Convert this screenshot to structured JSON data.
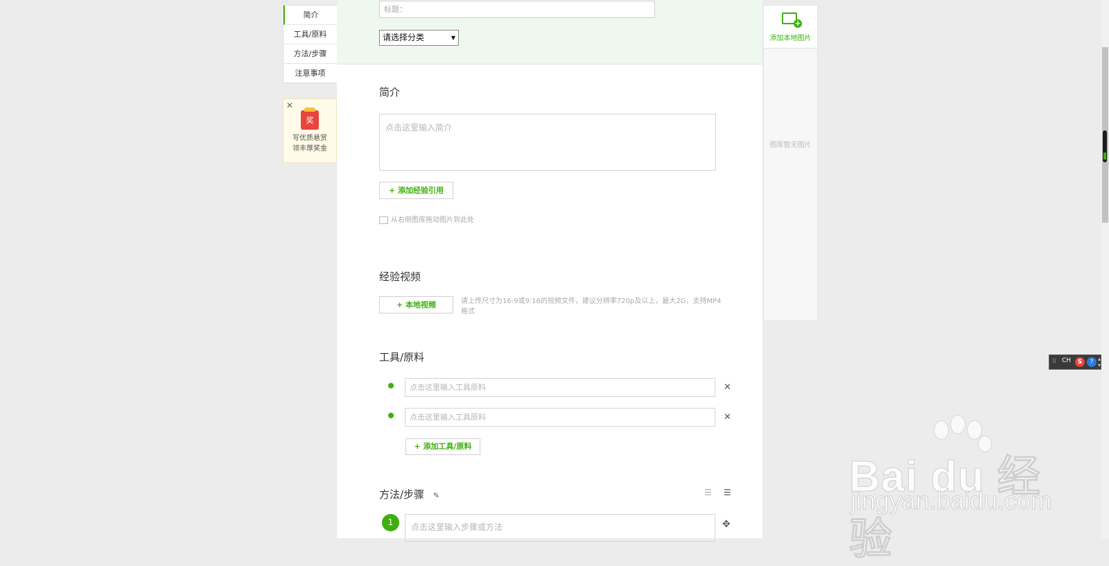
{
  "left_nav": {
    "items": [
      {
        "label": "简介",
        "active": true
      },
      {
        "label": "工具/原料",
        "active": false
      },
      {
        "label": "方法/步骤",
        "active": false
      },
      {
        "label": "注意事项",
        "active": false
      }
    ]
  },
  "promo": {
    "icon_text": "奖",
    "line1": "写优质悬赏",
    "line2": "领丰厚奖金"
  },
  "header": {
    "title_placeholder": "标题：",
    "category_select": "请选择分类"
  },
  "intro": {
    "title": "简介",
    "placeholder": "点击这里输入简介",
    "add_ref_button": "+ 添加经验引用",
    "drag_hint": "从右侧图库拖动图片到此处"
  },
  "video": {
    "title": "经验视频",
    "local_video_button": "+ 本地视频",
    "hint": "请上传尺寸为16:9或9:16的视频文件，建议分辨率720p及以上，最大2G，支持MP4格式"
  },
  "tools": {
    "title": "工具/原料",
    "items": [
      {
        "placeholder": "点击这里输入工具原料"
      },
      {
        "placeholder": "点击这里输入工具原料"
      }
    ],
    "add_button": "+ 添加工具/原料"
  },
  "steps": {
    "title": "方法/步骤",
    "items": [
      {
        "number": "1",
        "placeholder": "点击这里输入步骤或方法"
      }
    ]
  },
  "gallery": {
    "add_local_label": "添加本地图片",
    "empty_text": "图库暂无图片"
  },
  "ime": {
    "mode": "CH",
    "logo": "S",
    "help": "?"
  },
  "watermark": {
    "logo": "Bai du 经验",
    "url": "jingyan.baidu.com"
  },
  "colors": {
    "accent": "#3eaf0e",
    "band": "#eef8ee",
    "background": "#ececec"
  }
}
